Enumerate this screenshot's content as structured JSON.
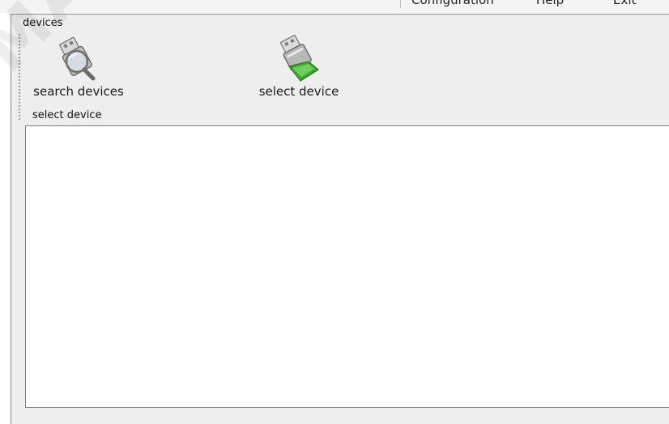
{
  "menubar": {
    "items": [
      {
        "label": "Configuration"
      },
      {
        "label": "Help"
      },
      {
        "label": "Exit"
      }
    ]
  },
  "window": {
    "group_title": "devices"
  },
  "toolbar": {
    "search_label": "search devices",
    "search_icon": "usb-search-icon",
    "select_label": "select device",
    "select_icon": "usb-select-icon"
  },
  "device_list": {
    "caption": "select device",
    "items": []
  },
  "watermark": {
    "text": "MAGNIQU"
  },
  "colors": {
    "window_bg": "#eeeeee",
    "list_bg": "#ffffff",
    "border": "#7d7d7d",
    "select_accent": "#3fa535"
  }
}
